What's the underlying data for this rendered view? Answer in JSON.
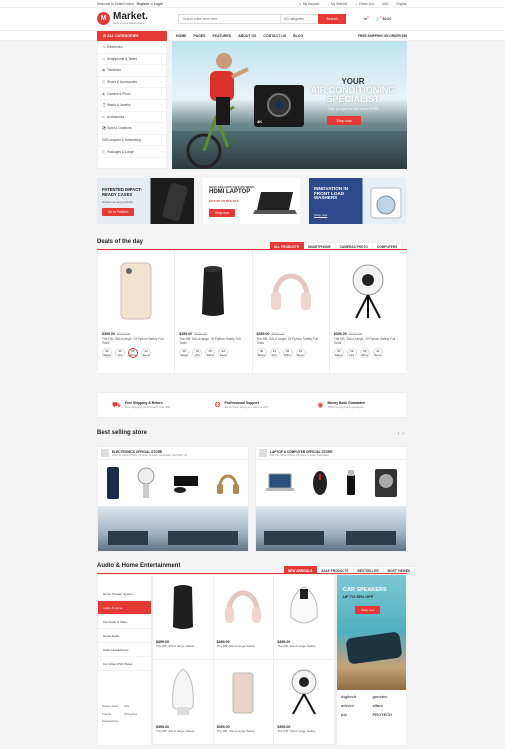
{
  "topbar": {
    "welcome": "Welcome to Default visitor",
    "register": "Register",
    "or": "or",
    "login": "Login",
    "links": [
      "My Account",
      "My Wishlist",
      "Check Out",
      "USD",
      "English"
    ]
  },
  "header": {
    "logo_mark": "M",
    "logo_title": "Market.",
    "logo_sub": "Multi-vendor Marketplace",
    "search_placeholder": "Search entire store here...",
    "search_category": "All Categories",
    "search_button": "Search",
    "compare_count": "0",
    "cart_count": "0",
    "cart_total": "$0.00"
  },
  "nav": {
    "all_categories": "ALL CATEGORIES",
    "menu": [
      "HOME",
      "PAGES",
      "FEATURES",
      "ABOUT US",
      "CONTACT US",
      "BLOG"
    ],
    "shipping_note": "FREE SHIPPING ON ORDER $99"
  },
  "sidebar": {
    "items": [
      {
        "icon": "phone-icon",
        "label": "Electronics"
      },
      {
        "icon": "tablet-icon",
        "label": "Smartphone & Tablet"
      },
      {
        "icon": "tv-icon",
        "label": "Television"
      },
      {
        "icon": "bag-icon",
        "label": "Shoes & Accessories"
      },
      {
        "icon": "camera-icon",
        "label": "Camera & Photo"
      },
      {
        "icon": "watch-icon",
        "label": "Watch & Jewelry"
      },
      {
        "icon": "glasses-icon",
        "label": "Accessories"
      },
      {
        "icon": "sport-icon",
        "label": "Sport & Outdoors"
      },
      {
        "icon": "computer-icon",
        "label": "Computer & Networking"
      },
      {
        "icon": "bag-icon",
        "label": "Packages & Lunge"
      }
    ]
  },
  "hero": {
    "line1": "YOUR",
    "line2": "AIR CONDITIONING",
    "line3": "SPECIALIST",
    "sub": "Help you get the you need NOW!",
    "button": "Shop now",
    "cam_label": "4K"
  },
  "promos": [
    {
      "title": "PATENTED IMPACT-READY CASES",
      "sub": "Check our app portfolio",
      "button": "Go to Portfolio"
    },
    {
      "title": "HDMI LAPTOP",
      "kicker": "BEST SELLERS ON THIS WEEK",
      "sub": "GET UP TO 50% OFF",
      "button": "Shop now"
    },
    {
      "title": "INNOVATION IN FRONT LOAD WASHERS",
      "sub": "Shop now"
    }
  ],
  "deals": {
    "title": "Deals of the day",
    "tabs": [
      "ALL PRODUCTS",
      "SMARTPHONE",
      "CAMERAS PHOTO",
      "COMPUTERS"
    ],
    "items": [
      {
        "price": "$399.00",
        "old": "$520.00",
        "name": "The DB: SALA range. Of Python Safety Full Tools"
      },
      {
        "price": "$399.00",
        "old": "$520.00",
        "name": "The DB: SALA range. Of Python Safety Full Tools"
      },
      {
        "price": "$399.00",
        "old": "$520.00",
        "name": "The DB: SALA range. Of Python Safety Full Tools"
      },
      {
        "price": "$399.00",
        "old": "$520.00",
        "name": "The DB: SALA range. Of Python Safety Full Tools"
      }
    ],
    "countdown": [
      {
        "n": "06",
        "u": "Days"
      },
      {
        "n": "19",
        "u": "Hrs"
      },
      {
        "n": "05",
        "u": "Mins"
      },
      {
        "n": "34",
        "u": "Secs"
      }
    ]
  },
  "features": [
    {
      "icon": "truck-icon",
      "title": "Free Shipping & Return",
      "sub": "Free Shipping on all orders over $99"
    },
    {
      "icon": "lifebuoy-icon",
      "title": "Professional Support",
      "sub": "We're there when you need us 24/7"
    },
    {
      "icon": "money-icon",
      "title": "Money Back Guarantee",
      "sub": "100% money back guarantee"
    }
  ],
  "best": {
    "title": "Best selling store",
    "stores": [
      {
        "name": "ELECTRONICS OFFICIAL STORE",
        "addr": "2514 St. Mount Plaza, Kingston Greater, Newcastle NH 2049, UK"
      },
      {
        "name": "LAPTOP & COMPUTER OFFICIAL STORE",
        "addr": "2514 St. Mount Plaza, Kingston Greater, Newcastle"
      }
    ]
  },
  "audio": {
    "title": "Audio & Home Entertainment",
    "tabs": [
      "NEW ARRIVALS",
      "SALE PRODUCTS",
      "BESTSELLER",
      "MOST VIEWED"
    ],
    "side": [
      "Home Theater System",
      "Audio & Home",
      "Car Audio & Video",
      "Home Audio",
      "Audio Headphones",
      "Car Video DVD Player"
    ],
    "tags": [
      "Stores sport",
      "Kits",
      "Trends",
      "Shopping",
      "Accessories"
    ],
    "items": [
      {
        "price": "$399.00",
        "name": "The DB: SALA range Safety"
      },
      {
        "price": "$399.00",
        "name": "The DB: SALA range Safety"
      },
      {
        "price": "$399.00",
        "name": "The DB: SALA range Safety"
      },
      {
        "price": "$399.00",
        "name": "The DB: SALA range Safety"
      },
      {
        "price": "$399.00",
        "name": "The DB: SALA range Safety"
      },
      {
        "price": "$399.00",
        "name": "The DB: SALA range Safety"
      }
    ],
    "banner_title": "CAR SPEAKERS",
    "banner_sub": "UP TO 25% OFF",
    "banner_button": "Shop now",
    "brands": [
      "digitech",
      "genetec",
      "advent",
      "alfam",
      "ptc",
      "PROTECH"
    ]
  }
}
